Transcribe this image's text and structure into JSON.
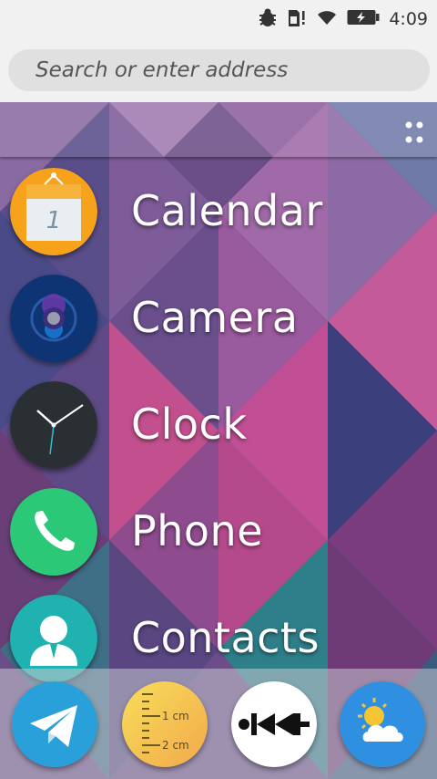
{
  "status": {
    "time": "4:09",
    "icons": [
      "debug-bug-icon",
      "sim-alert-icon",
      "wifi-icon",
      "battery-charging-icon"
    ]
  },
  "search": {
    "placeholder": "Search or enter address"
  },
  "apps": [
    {
      "label": "Calendar",
      "icon": "calendar-icon",
      "day": "1",
      "color": "#f7a21b"
    },
    {
      "label": "Camera",
      "icon": "camera-icon",
      "color": "#0e3474"
    },
    {
      "label": "Clock",
      "icon": "clock-icon",
      "color": "#2a2f33"
    },
    {
      "label": "Phone",
      "icon": "phone-icon",
      "color": "#2bc878"
    },
    {
      "label": "Contacts",
      "icon": "contacts-icon",
      "color": "#1fb2b0"
    }
  ],
  "dock": [
    {
      "icon": "telegram-icon",
      "color": "#2aa0da"
    },
    {
      "icon": "ruler-icon",
      "color": "#f4c84a",
      "mark1": "1 cm",
      "mark2": "2 cm"
    },
    {
      "icon": "rewind-track-icon",
      "color": "#ffffff"
    },
    {
      "icon": "weather-icon",
      "color": "#2f8fe0"
    }
  ]
}
